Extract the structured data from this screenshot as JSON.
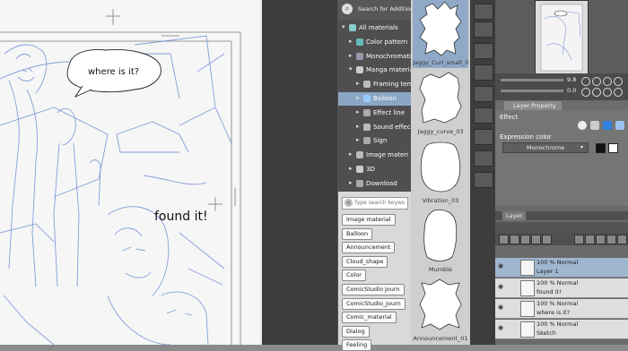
{
  "canvas": {
    "speech_bubble_text": "where is it?",
    "caption_text": "found it!"
  },
  "material_panel": {
    "search_placeholder": "Search for Additional",
    "tree": [
      {
        "label": "All materials",
        "level": 0,
        "expanded": true,
        "selected": false,
        "icon": "globe-icon"
      },
      {
        "label": "Color pattern",
        "level": 1,
        "expanded": false,
        "selected": false,
        "icon": "pattern-icon"
      },
      {
        "label": "Monochromatic",
        "level": 1,
        "expanded": false,
        "selected": false,
        "icon": "mono-icon"
      },
      {
        "label": "Manga material",
        "level": 1,
        "expanded": true,
        "selected": false,
        "icon": "manga-icon"
      },
      {
        "label": "Framing tem",
        "level": 2,
        "expanded": false,
        "selected": false,
        "icon": "frame-icon"
      },
      {
        "label": "Balloon",
        "level": 2,
        "expanded": false,
        "selected": true,
        "icon": "balloon-icon"
      },
      {
        "label": "Effect line",
        "level": 2,
        "expanded": false,
        "selected": false,
        "icon": "effect-line-icon"
      },
      {
        "label": "Sound effec",
        "level": 2,
        "expanded": false,
        "selected": false,
        "icon": "sound-icon"
      },
      {
        "label": "Sign",
        "level": 2,
        "expanded": false,
        "selected": false,
        "icon": "sign-icon"
      },
      {
        "label": "Image materi",
        "level": 1,
        "expanded": false,
        "selected": false,
        "icon": "image-icon"
      },
      {
        "label": "3D",
        "level": 1,
        "expanded": false,
        "selected": false,
        "icon": "3d-icon"
      },
      {
        "label": "Download",
        "level": 1,
        "expanded": false,
        "selected": false,
        "icon": "download-icon"
      }
    ],
    "tag_search_placeholder": "Type search keywords",
    "tags": [
      "Image material",
      "Balloon",
      "Announcement",
      "Cloud_shape",
      "Color",
      "ComicStudio journ",
      "ComicStudio_journ",
      "Comic_material",
      "Dialog",
      "Feeling"
    ]
  },
  "material_list": [
    {
      "label": "Jaggy_Curl_small_02",
      "selected": true
    },
    {
      "label": "Jaggy_curve_03",
      "selected": false
    },
    {
      "label": "Vibration_03",
      "selected": false
    },
    {
      "label": "Mumble",
      "selected": false
    },
    {
      "label": "Announcement_01",
      "selected": false
    }
  ],
  "navigator": {
    "zoom_value": "9.8",
    "angle_value": "0.0"
  },
  "layer_property": {
    "tab_label": "Layer Property",
    "effect_label": "Effect",
    "expression_color_label": "Expression color",
    "expression_color_value": "Monochrome"
  },
  "layer_panel": {
    "tab_label": "Layer",
    "layers": [
      {
        "mode": "100 % Normal",
        "name": "Layer 1",
        "selected": true
      },
      {
        "mode": "100 % Normal",
        "name": "found it!",
        "selected": false
      },
      {
        "mode": "100 % Normal",
        "name": "where is it?",
        "selected": false
      },
      {
        "mode": "100 % Normal",
        "name": "Sketch",
        "selected": false
      }
    ]
  },
  "colors": {
    "selection_blue": "#8aa6c4",
    "sketch_blue": "#6f8fd6",
    "panel_dark": "#3c3c3c"
  }
}
